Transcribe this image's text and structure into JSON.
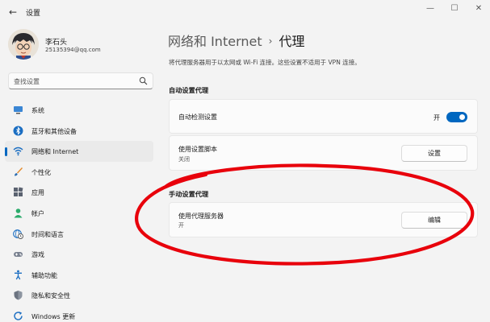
{
  "window": {
    "title": "设置",
    "back_glyph": "←",
    "controls": {
      "minimize": "—",
      "maximize": "☐",
      "close": "✕"
    }
  },
  "user": {
    "name": "李石头",
    "email": "25135394@qq.com"
  },
  "search": {
    "placeholder": "查找设置"
  },
  "sidebar": {
    "items": [
      {
        "label": "系统",
        "icon": "monitor-icon",
        "active": false
      },
      {
        "label": "蓝牙和其他设备",
        "icon": "bluetooth-icon",
        "active": false
      },
      {
        "label": "网络和 Internet",
        "icon": "wifi-icon",
        "active": true
      },
      {
        "label": "个性化",
        "icon": "paintbrush-icon",
        "active": false
      },
      {
        "label": "应用",
        "icon": "apps-icon",
        "active": false
      },
      {
        "label": "帐户",
        "icon": "person-icon",
        "active": false
      },
      {
        "label": "时间和语言",
        "icon": "globe-clock-icon",
        "active": false
      },
      {
        "label": "游戏",
        "icon": "gamepad-icon",
        "active": false
      },
      {
        "label": "辅助功能",
        "icon": "accessibility-icon",
        "active": false
      },
      {
        "label": "隐私和安全性",
        "icon": "shield-icon",
        "active": false
      },
      {
        "label": "Windows 更新",
        "icon": "update-icon",
        "active": false
      }
    ]
  },
  "header": {
    "parent": "网络和 Internet",
    "separator": "›",
    "current": "代理"
  },
  "description": "将代理服务器用于以太网或 Wi-Fi 连接。这些设置不适用于 VPN 连接。",
  "auto_proxy": {
    "title": "自动设置代理",
    "detect": {
      "label": "自动检测设置",
      "state_text": "开",
      "on": true
    },
    "script": {
      "label": "使用设置脚本",
      "sub": "关闭",
      "button": "设置"
    }
  },
  "manual_proxy": {
    "title": "手动设置代理",
    "server": {
      "label": "使用代理服务器",
      "sub": "开",
      "button": "编辑"
    }
  },
  "colors": {
    "accent": "#0067c0",
    "annotation": "#e8000b",
    "background": "#f3f3f3",
    "card": "#fbfbfb"
  }
}
